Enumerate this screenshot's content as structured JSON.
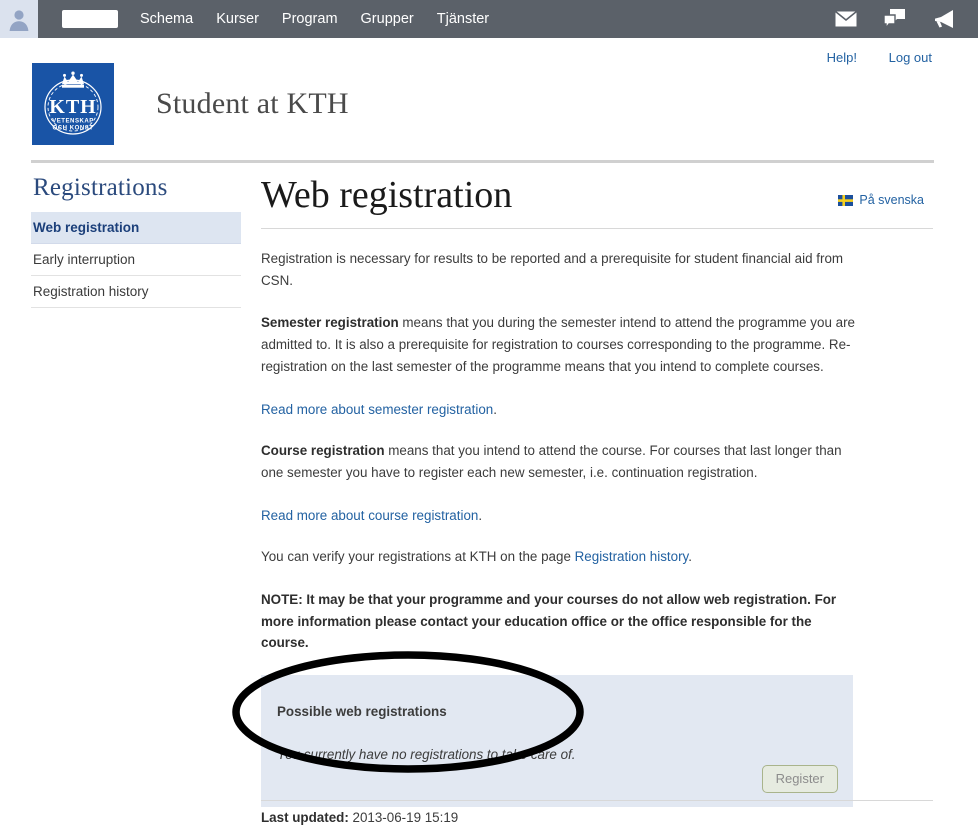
{
  "topbar": {
    "avatar_icon": "user-avatar-icon",
    "user_name_redacted": "",
    "nav": [
      {
        "label": "Schema"
      },
      {
        "label": "Kurser"
      },
      {
        "label": "Program"
      },
      {
        "label": "Grupper"
      },
      {
        "label": "Tjänster"
      }
    ],
    "icons": [
      {
        "name": "mail-icon"
      },
      {
        "name": "chat-icon"
      },
      {
        "name": "megaphone-icon"
      }
    ],
    "background_color": "#5b6169"
  },
  "header": {
    "help_label": "Help!",
    "logout_label": "Log out",
    "logo": {
      "name": "kth-logo",
      "main_text": "KTH",
      "sub_text_line1": "VETENSKAP",
      "sub_text_line2": "OCH KONST",
      "color": "#1954a6"
    },
    "site_title": "Student at KTH"
  },
  "sidebar": {
    "heading": "Registrations",
    "items": [
      {
        "label": "Web registration",
        "active": true
      },
      {
        "label": "Early interruption",
        "active": false
      },
      {
        "label": "Registration history",
        "active": false
      }
    ]
  },
  "main": {
    "title": "Web registration",
    "language_link": {
      "label": "På svenska",
      "flag": "swedish-flag-icon"
    },
    "paragraphs": {
      "intro": "Registration is necessary for results to be reported and a prerequisite for student financial aid from CSN.",
      "semester_bold": "Semester registration",
      "semester_rest": " means that you during the semester intend to attend the programme you are admitted to. It is also a prerequisite for registration to courses corresponding to the programme. Re-registration on the last semester of the programme means that you intend to complete courses.",
      "link_semester": "Read more about semester registration",
      "course_bold": "Course registration",
      "course_rest": " means that you intend to attend the course. For courses that last longer than one semester you have to register each new semester, i.e. continuation registration.",
      "link_course": "Read more about course registration",
      "verify_pre": "You can verify your registrations at KTH on the page ",
      "link_history": "Registration history",
      "verify_post": ".",
      "note": "NOTE: It may be that your programme and your courses do not allow web registration. For more information please contact your education office or the office responsible for the course."
    },
    "registration_box": {
      "title": "Possible web registrations",
      "empty_message": "You currently have no registrations to take care of.",
      "button_label": "Register",
      "button_disabled": true,
      "background_color": "#e2e8f2",
      "title_color": "#8a8a24"
    },
    "annotation": {
      "shape": "ellipse",
      "color": "#000000"
    }
  },
  "footer": {
    "last_updated_label": "Last updated:",
    "last_updated_value": " 2013-06-19 15:19"
  }
}
